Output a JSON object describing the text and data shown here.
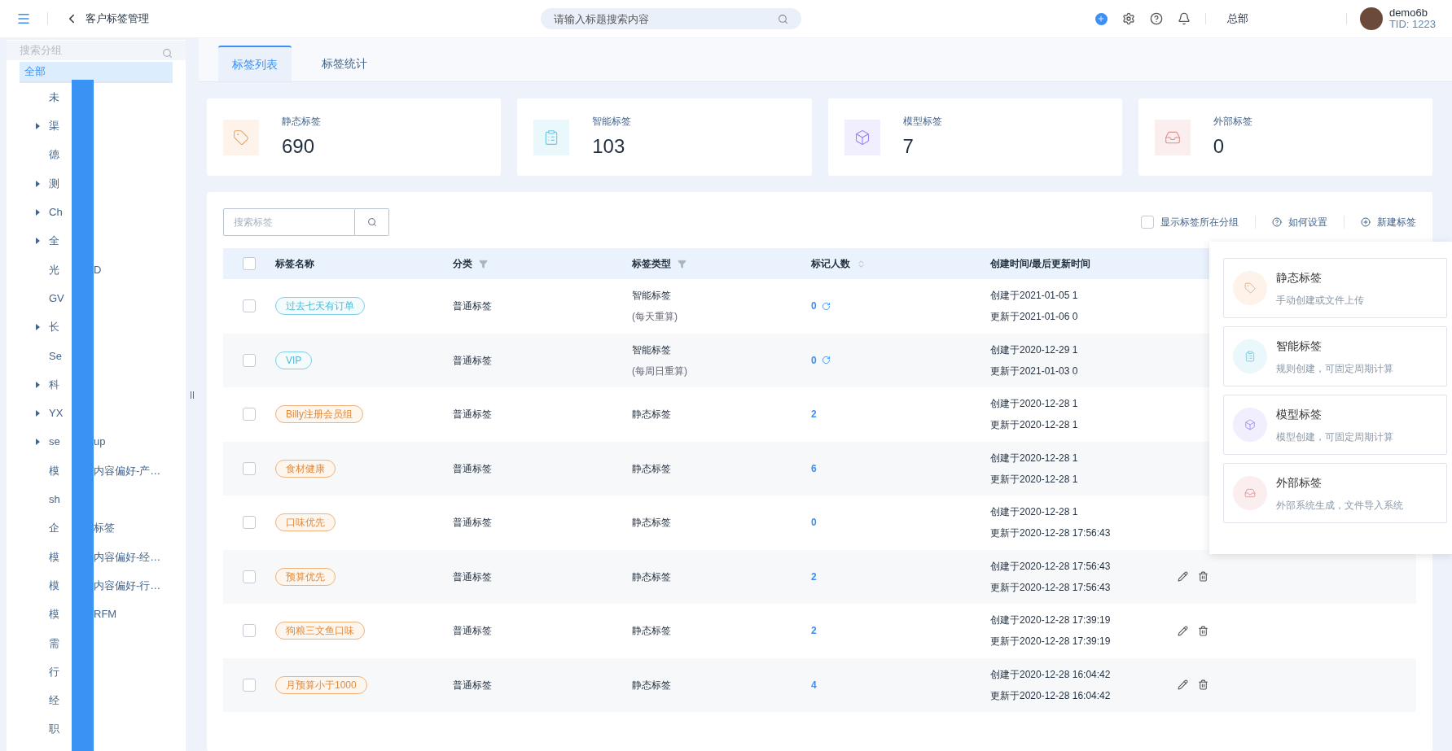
{
  "topbar": {
    "title": "客户标签管理",
    "search": {
      "placeholder": "请输入标题搜索内容"
    },
    "org": "总部",
    "user": {
      "name": "demo6b",
      "tid": "TID: 1223"
    }
  },
  "sidebar": {
    "search": {
      "placeholder": "搜索分组"
    },
    "root": {
      "label": "全部",
      "selected": true
    },
    "items": [
      {
        "before": "未",
        "expandable": false,
        "selected": false
      },
      {
        "before": "渠",
        "expandable": true,
        "selected": false
      },
      {
        "before": "德",
        "expandable": false,
        "selected": false
      },
      {
        "before": "测",
        "expandable": true,
        "selected": false
      },
      {
        "before": "Ch",
        "expandable": true,
        "selected": false
      },
      {
        "before": "全",
        "expandable": true,
        "selected": false
      },
      {
        "before": "光",
        "after": "D",
        "expandable": false,
        "selected": false
      },
      {
        "before": "GV",
        "expandable": false,
        "selected": false
      },
      {
        "before": "长",
        "expandable": true,
        "selected": false
      },
      {
        "before": "Se",
        "expandable": false,
        "selected": false
      },
      {
        "before": "科",
        "expandable": true,
        "selected": false
      },
      {
        "before": "YX",
        "expandable": true,
        "selected": false
      },
      {
        "before": "se",
        "after": "up",
        "expandable": true,
        "selected": false
      },
      {
        "before": "模",
        "after": "内容偏好-产…",
        "expandable": false,
        "selected": false
      },
      {
        "before": "sh",
        "expandable": false,
        "selected": false
      },
      {
        "before": "企",
        "after": "标签",
        "expandable": false,
        "selected": false
      },
      {
        "before": "模",
        "after": "内容偏好-经…",
        "expandable": false,
        "selected": false
      },
      {
        "before": "模",
        "after": "内容偏好-行…",
        "expandable": false,
        "selected": false
      },
      {
        "before": "模",
        "after": "RFM",
        "expandable": false,
        "selected": false
      },
      {
        "before": "需",
        "expandable": false,
        "selected": false
      },
      {
        "before": "行",
        "expandable": false,
        "selected": false
      },
      {
        "before": "经",
        "expandable": false,
        "selected": false
      },
      {
        "before": "职",
        "expandable": false,
        "selected": false
      }
    ]
  },
  "tabs": [
    {
      "label": "标签列表",
      "selected": true
    },
    {
      "label": "标签统计",
      "selected": false
    }
  ],
  "stats": [
    {
      "kind": "static",
      "label": "静态标签",
      "value": "690"
    },
    {
      "kind": "smart",
      "label": "智能标签",
      "value": "103"
    },
    {
      "kind": "model",
      "label": "模型标签",
      "value": "7"
    },
    {
      "kind": "external",
      "label": "外部标签",
      "value": "0"
    }
  ],
  "toolbar": {
    "search": {
      "placeholder": "搜索标签"
    },
    "show_group": {
      "label": "显示标签所在分组",
      "checked": false
    },
    "help": "如何设置",
    "create": "新建标签"
  },
  "table": {
    "all_checked": false,
    "columns": [
      {
        "label": "标签名称"
      },
      {
        "label": "分类"
      },
      {
        "label": "标签类型"
      },
      {
        "label": "标记人数"
      },
      {
        "label": "创建时间/最后更新时间"
      }
    ],
    "rows": [
      {
        "checked": false,
        "tag": "过去七天有订单",
        "kind": "smart",
        "category": "普通标签",
        "type": "智能标签",
        "type_note": "(每天重算)",
        "count": "0",
        "refresh": true,
        "created": "创建于2021-01-05 1",
        "updated": "更新于2021-01-06 0",
        "actions": false
      },
      {
        "checked": false,
        "tag": "VIP",
        "kind": "smart",
        "category": "普通标签",
        "type": "智能标签",
        "type_note": "(每周日重算)",
        "count": "0",
        "refresh": true,
        "created": "创建于2020-12-29 1",
        "updated": "更新于2021-01-03 0",
        "actions": false
      },
      {
        "checked": false,
        "tag": "Billy注册会员组",
        "kind": "static",
        "category": "普通标签",
        "type": "静态标签",
        "count": "2",
        "refresh": false,
        "created": "创建于2020-12-28 1",
        "updated": "更新于2020-12-28 1",
        "actions": false
      },
      {
        "checked": false,
        "tag": "食材健康",
        "kind": "static",
        "category": "普通标签",
        "type": "静态标签",
        "count": "6",
        "refresh": false,
        "created": "创建于2020-12-28 1",
        "updated": "更新于2020-12-28 1",
        "actions": false
      },
      {
        "checked": false,
        "tag": "口味优先",
        "kind": "static",
        "category": "普通标签",
        "type": "静态标签",
        "count": "0",
        "refresh": false,
        "created": "创建于2020-12-28 1",
        "updated": "更新于2020-12-28 17:56:43",
        "actions": false
      },
      {
        "checked": false,
        "tag": "预算优先",
        "kind": "static",
        "category": "普通标签",
        "type": "静态标签",
        "count": "2",
        "refresh": false,
        "created": "创建于2020-12-28 17:56:43",
        "updated": "更新于2020-12-28 17:56:43",
        "actions": true
      },
      {
        "checked": false,
        "tag": "狗粮三文鱼口味",
        "kind": "static",
        "category": "普通标签",
        "type": "静态标签",
        "count": "2",
        "refresh": false,
        "created": "创建于2020-12-28 17:39:19",
        "updated": "更新于2020-12-28 17:39:19",
        "actions": true
      },
      {
        "checked": false,
        "tag": "月预算小于1000",
        "kind": "static",
        "category": "普通标签",
        "type": "静态标签",
        "count": "4",
        "refresh": false,
        "created": "创建于2020-12-28 16:04:42",
        "updated": "更新于2020-12-28 16:04:42",
        "actions": true
      }
    ]
  },
  "create_menu": [
    {
      "kind": "static",
      "title": "静态标签",
      "desc": "手动创建或文件上传"
    },
    {
      "kind": "smart",
      "title": "智能标签",
      "desc": "规则创建，可固定周期计算"
    },
    {
      "kind": "model",
      "title": "模型标签",
      "desc": "模型创建，可固定周期计算"
    },
    {
      "kind": "external",
      "title": "外部标签",
      "desc": "外部系统生成，文件导入系统"
    }
  ]
}
